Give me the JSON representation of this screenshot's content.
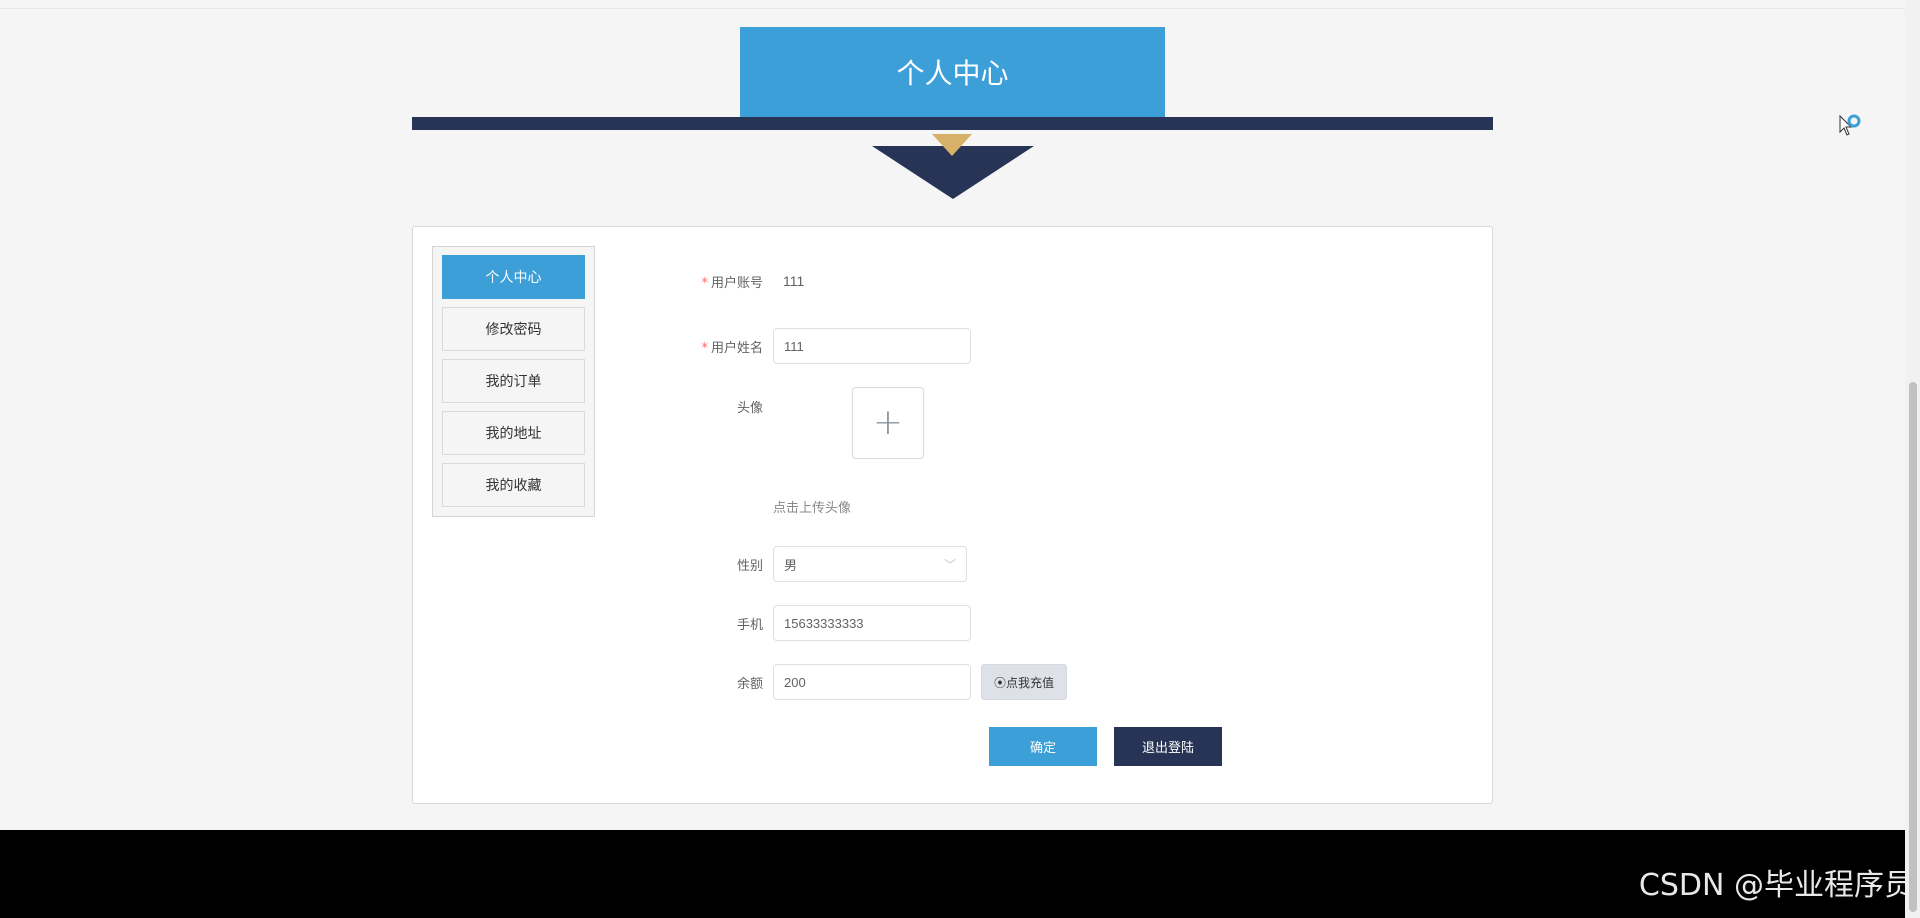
{
  "header": {
    "title": "个人中心"
  },
  "sidebar": {
    "items": [
      {
        "label": "个人中心",
        "active": true
      },
      {
        "label": "修改密码"
      },
      {
        "label": "我的订单"
      },
      {
        "label": "我的地址"
      },
      {
        "label": "我的收藏"
      }
    ]
  },
  "form": {
    "account": {
      "label": "用户账号",
      "required": "*",
      "value": "111"
    },
    "name": {
      "label": "用户姓名",
      "required": "*",
      "value": "111"
    },
    "avatar": {
      "label": "头像",
      "upload_symbol": "+",
      "tip": "点击上传头像"
    },
    "gender": {
      "label": "性别",
      "value": "男"
    },
    "phone": {
      "label": "手机",
      "value": "15633333333"
    },
    "balance": {
      "label": "余额",
      "value": "200",
      "recharge_label": "⦿点我充值"
    }
  },
  "actions": {
    "confirm_label": "确定",
    "logout_label": "退出登陆"
  },
  "watermark": "CSDN @毕业程序员",
  "colors": {
    "primary": "#3d9fd7",
    "navy": "#273455",
    "gold": "#d8b168"
  },
  "icons": [
    "plus-icon",
    "chevron-down-icon",
    "cursor-icon"
  ]
}
